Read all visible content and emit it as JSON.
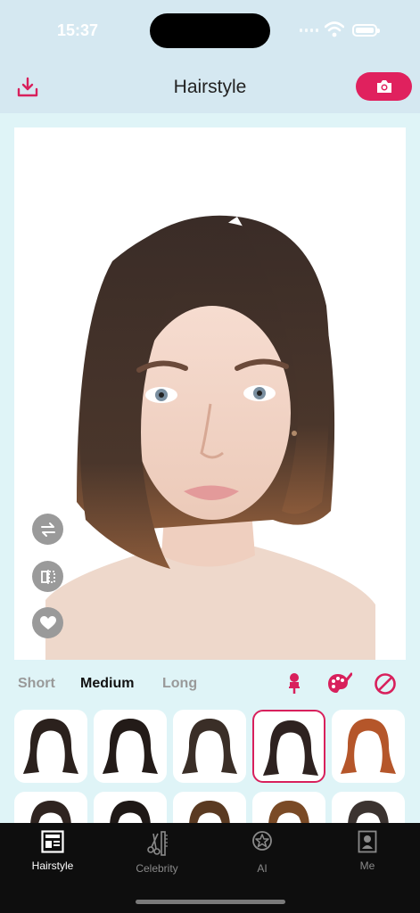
{
  "status_bar": {
    "time": "15:37"
  },
  "header": {
    "title": "Hairstyle",
    "download_icon": "download-icon",
    "camera_icon": "camera-icon",
    "accent_color": "#e0215e"
  },
  "canvas": {
    "side_buttons": [
      "swap-icon",
      "mirror-icon",
      "heart-icon"
    ]
  },
  "categories": [
    {
      "label": "Short",
      "active": false
    },
    {
      "label": "Medium",
      "active": true
    },
    {
      "label": "Long",
      "active": false
    }
  ],
  "tools": [
    "pin-icon",
    "palette-icon",
    "no-entry-icon"
  ],
  "hairstyle_grid": {
    "selected_index": 3,
    "row1_colors": [
      "#2b211d",
      "#231b18",
      "#3a2e27",
      "#2e2220",
      "#b5562a"
    ],
    "row2_colors": [
      "#2f2420",
      "#1e1816",
      "#5a3a22",
      "#7a4a26",
      "#3b3330"
    ]
  },
  "tabbar": {
    "tabs": [
      {
        "label": "Hairstyle",
        "icon": "newspaper-icon",
        "active": true
      },
      {
        "label": "Celebrity",
        "icon": "scissors-comb-icon",
        "active": false
      },
      {
        "label": "AI",
        "icon": "star-badge-icon",
        "active": false
      },
      {
        "label": "Me",
        "icon": "profile-card-icon",
        "active": false
      }
    ]
  }
}
